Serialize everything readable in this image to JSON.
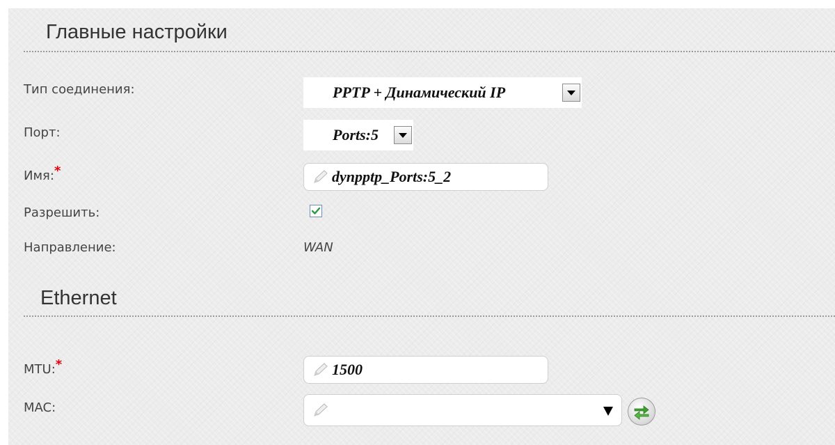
{
  "main_section": {
    "title": "Главные настройки",
    "connection_type": {
      "label": "Тип соединения:",
      "value": "PPTP + Динамический IP"
    },
    "port": {
      "label": "Порт:",
      "value": "Ports:5"
    },
    "name": {
      "label": "Имя:",
      "required_mark": "*",
      "value": "dynpptp_Ports:5_2"
    },
    "enable": {
      "label": "Разрешить:",
      "checked": true
    },
    "direction": {
      "label": "Направление:",
      "value": "WAN"
    }
  },
  "ethernet_section": {
    "title": "Ethernet",
    "mtu": {
      "label": "MTU:",
      "required_mark": "*",
      "value": "1500"
    },
    "mac": {
      "label": "MAC:",
      "value": ""
    }
  },
  "icons": {
    "field_icon": "pencil-icon",
    "dropdown": "chevron-down-icon",
    "refresh": "refresh-arrows-icon"
  },
  "colors": {
    "background": "#ececec",
    "required": "#e0000f",
    "checkbox_check": "#2b9a45",
    "refresh_arrows": "#3f9f2f"
  }
}
